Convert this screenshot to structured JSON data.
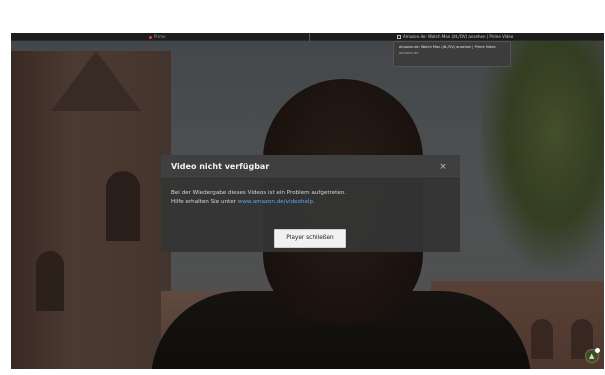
{
  "topbar": {
    "tab_a": "Prime",
    "tab_c": "Amazon.de: Watch Man (dt./OV) ansehen | Prime Video"
  },
  "tooltip": {
    "title": "Amazon.de: Watch Man (dt./OV) ansehen | Prime Video",
    "sub": "amazon.de"
  },
  "dialog": {
    "title": "Video nicht verfügbar",
    "close_glyph": "×",
    "body_line1": "Bei der Wiedergabe dieses Videos ist ein Problem aufgetreten.",
    "body_line2_prefix": "Hilfe erhalten Sie unter ",
    "help_link": "www.amazon.de/videohelp",
    "body_line2_suffix": ".",
    "button_label": "Player schließen"
  },
  "icons": {
    "close": "close-icon",
    "badge": "assistant-badge-icon"
  },
  "colors": {
    "dialog_bg": "#343434",
    "link": "#5fa8e8",
    "button_bg": "#f1f1f1"
  }
}
